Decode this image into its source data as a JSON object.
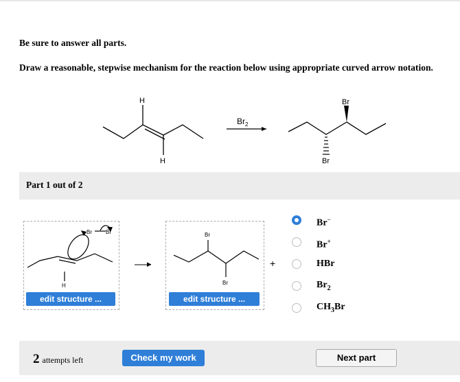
{
  "instructions": {
    "line1": "Be sure to answer all parts.",
    "line2": "Draw a reasonable, stepwise mechanism for the reaction below using appropriate curved arrow notation."
  },
  "reaction": {
    "reactant_H_top": "H",
    "reactant_H_bottom": "H",
    "reagent": "Br",
    "reagent_sub": "2",
    "product_Br_top": "Br",
    "product_Br_bottom": "Br"
  },
  "part": {
    "label": "Part 1 out of 2"
  },
  "mechanism": {
    "left_structure": {
      "br_left": "Br",
      "br_right": "Br",
      "h_label": "H",
      "edit_label": "edit structure ..."
    },
    "middle_structure": {
      "br_top": "Br",
      "br_bottom": "Br",
      "edit_label": "edit structure ..."
    },
    "plus": "+"
  },
  "options": [
    {
      "text": "Br",
      "sup": "−",
      "sub": "",
      "selected": true
    },
    {
      "text": "Br",
      "sup": "+",
      "sub": "",
      "selected": false
    },
    {
      "text": "HBr",
      "sup": "",
      "sub": "",
      "selected": false
    },
    {
      "text": "Br",
      "sup": "",
      "sub": "2",
      "selected": false
    },
    {
      "text": "CH",
      "sup": "",
      "sub": "3",
      "tail": "Br",
      "selected": false
    }
  ],
  "footer": {
    "attempts_count": "2",
    "attempts_label": "attempts left",
    "check_label": "Check my work",
    "next_label": "Next part"
  },
  "colors": {
    "accent": "#2f7fd8"
  }
}
